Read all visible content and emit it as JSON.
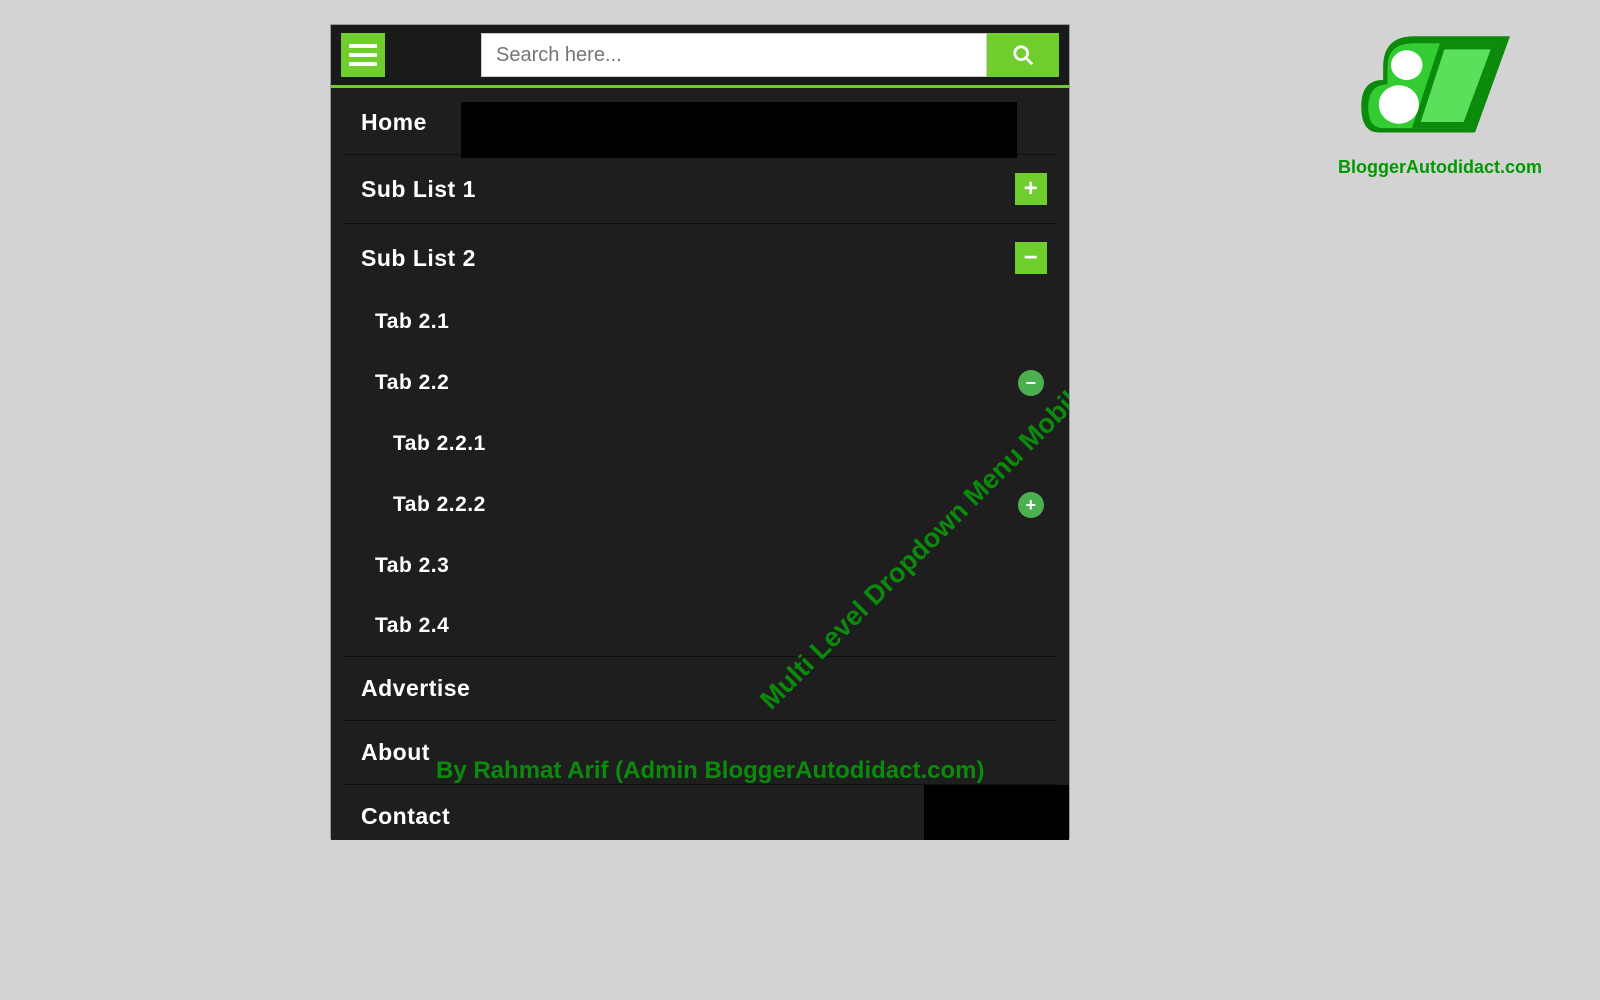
{
  "search": {
    "placeholder": "Search here..."
  },
  "menu": {
    "home": "Home",
    "sublist1": "Sub List 1",
    "sublist2": "Sub List 2",
    "tab21": "Tab 2.1",
    "tab22": "Tab 2.2",
    "tab221": "Tab 2.2.1",
    "tab222": "Tab 2.2.2",
    "tab23": "Tab 2.3",
    "tab24": "Tab 2.4",
    "advertise": "Advertise",
    "about": "About",
    "contact": "Contact"
  },
  "icons": {
    "plus": "+",
    "minus": "−"
  },
  "watermark": {
    "title": "Multi Level Dropdown Menu Mobile Version On Blogger",
    "byline": "By Rahmat Arif (Admin BloggerAutodidact.com)",
    "site": "BloggerAutodidact.com"
  },
  "colors": {
    "accent": "#6fce2e",
    "darkbg": "#1a1a1a",
    "panelbg": "#1e1e1e",
    "textgreen": "#0b8a0b"
  }
}
